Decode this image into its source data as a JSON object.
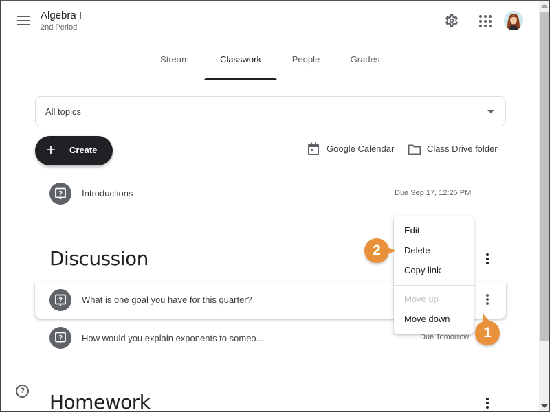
{
  "header": {
    "menu_icon": "hamburger-menu-icon",
    "class_name": "Algebra I",
    "section": "2nd Period",
    "settings_icon": "gear-icon",
    "apps_icon": "apps-grid-icon",
    "avatar": "user-avatar"
  },
  "tabs": [
    {
      "label": "Stream",
      "active": false
    },
    {
      "label": "Classwork",
      "active": true
    },
    {
      "label": "People",
      "active": false
    },
    {
      "label": "Grades",
      "active": false
    }
  ],
  "topics_filter": {
    "selected": "All topics"
  },
  "toolbar": {
    "create_label": "Create",
    "calendar_label": "Google Calendar",
    "drive_label": "Class Drive folder"
  },
  "items": [
    {
      "title": "Introductions",
      "due": "Due Sep 17, 12:25 PM",
      "icon": "question-icon"
    }
  ],
  "topics": [
    {
      "name": "Discussion",
      "items": [
        {
          "title": "What is one goal you have for this quarter?",
          "due": "",
          "icon": "question-icon"
        },
        {
          "title": "How would you explain exponents to someo...",
          "due": "Due Tomorrow",
          "icon": "question-icon"
        }
      ]
    },
    {
      "name": "Homework",
      "items": []
    }
  ],
  "context_menu": {
    "items": [
      {
        "label": "Edit",
        "disabled": false
      },
      {
        "label": "Delete",
        "disabled": false
      },
      {
        "label": "Copy link",
        "disabled": false
      },
      {
        "label": "Move up",
        "disabled": true
      },
      {
        "label": "Move down",
        "disabled": false
      }
    ]
  },
  "callouts": {
    "first": "1",
    "second": "2"
  },
  "help_label": "?",
  "colors": {
    "primary_dark": "#202124",
    "text_secondary": "#5f6368",
    "callout": "#e8913a",
    "border": "#dadce0"
  }
}
